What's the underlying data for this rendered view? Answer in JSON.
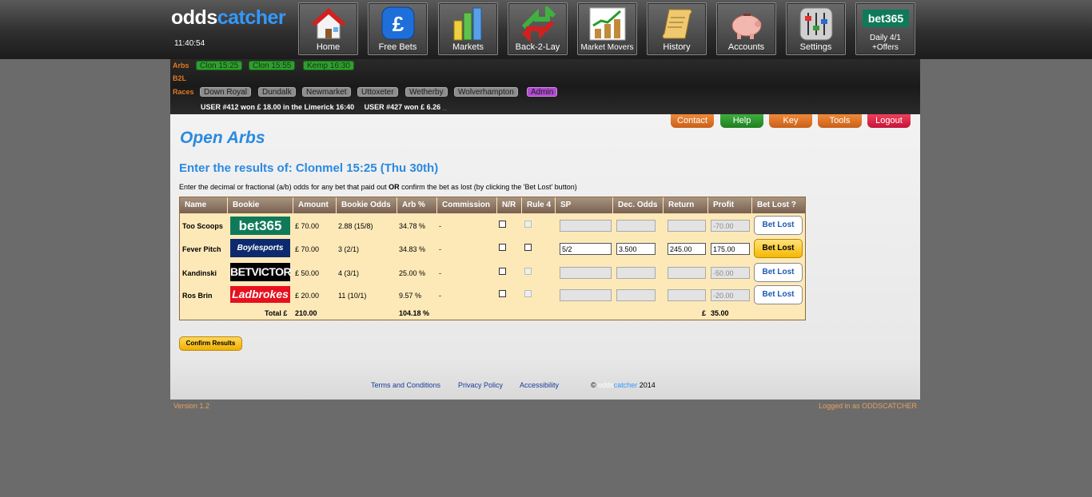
{
  "brand": {
    "part1": "odds",
    "part2": "catcher"
  },
  "clock": "11:40:54",
  "nav": [
    {
      "label": "Home",
      "icon": "home-icon"
    },
    {
      "label": "Free Bets",
      "icon": "pound-icon"
    },
    {
      "label": "Markets",
      "icon": "bar-chart-icon"
    },
    {
      "label": "Back-2-Lay",
      "icon": "arrows-icon"
    },
    {
      "label": "Market Movers",
      "icon": "trend-chart-icon"
    },
    {
      "label": "History",
      "icon": "scroll-icon"
    },
    {
      "label": "Accounts",
      "icon": "piggy-bank-icon"
    },
    {
      "label": "Settings",
      "icon": "sliders-icon"
    },
    {
      "label_line1": "Daily 4/1",
      "label_line2": "+Offers",
      "logo_text": "bet365",
      "icon": "bet365-logo"
    }
  ],
  "subnav": {
    "arbs_label": "Arbs",
    "arbs": [
      "Clon 15:25",
      "Clon 15:55",
      "Kemp 16:30"
    ],
    "b2l_label": "B2L",
    "races_label": "Races",
    "races": [
      "Down Royal",
      "Dundalk",
      "Newmarket",
      "Uttoxeter",
      "Wetherby",
      "Wolverhampton"
    ],
    "admin": "Admin",
    "ticker": "USER #412 won £ 18.00 in the Limerick 16:40     USER #427 won £ 6.26",
    "ticker_cursor": "_"
  },
  "top_buttons": {
    "contact": "Contact",
    "help": "Help",
    "key": "Key",
    "tools": "Tools",
    "logout": "Logout"
  },
  "page": {
    "title": "Open Arbs",
    "subtitle": "Enter the results of: Clonmel 15:25 (Thu 30th)",
    "instruction_pre": "Enter the decimal or fractional (a/b) odds for any bet that paid out ",
    "instruction_or": "OR",
    "instruction_post": " confirm the bet as lost (by clicking the 'Bet Lost' button)"
  },
  "table": {
    "headers": [
      "Name",
      "Bookie",
      "Amount",
      "Bookie Odds",
      "Arb %",
      "Commission",
      "N/R",
      "Rule 4",
      "SP",
      "Dec. Odds",
      "Return",
      "Profit",
      "Bet Lost ?"
    ],
    "rows": [
      {
        "name": "Too Scoops",
        "bookie": "bet365",
        "amount": "£ 70.00",
        "odds": "2.88 (15/8)",
        "arb": "34.78 %",
        "commission": "-",
        "sp": "",
        "dec": "",
        "return": "",
        "profit": "-70.00",
        "btn": "Bet Lost",
        "active": false
      },
      {
        "name": "Fever Pitch",
        "bookie": "Boylesports",
        "amount": "£ 70.00",
        "odds": "3 (2/1)",
        "arb": "34.83 %",
        "commission": "-",
        "sp": "5/2",
        "dec": "3.500",
        "return": "245.00",
        "profit": "175.00",
        "btn": "Bet Lost",
        "active": true
      },
      {
        "name": "Kandinski",
        "bookie": "BETVICTOR",
        "amount": "£ 50.00",
        "odds": "4 (3/1)",
        "arb": "25.00 %",
        "commission": "-",
        "sp": "",
        "dec": "",
        "return": "",
        "profit": "-50.00",
        "btn": "Bet Lost",
        "active": false
      },
      {
        "name": "Ros Brin",
        "bookie": "Ladbrokes",
        "amount": "£ 20.00",
        "odds": "11 (10/1)",
        "arb": "9.57 %",
        "commission": "-",
        "sp": "",
        "dec": "",
        "return": "",
        "profit": "-20.00",
        "btn": "Bet Lost",
        "active": false
      }
    ],
    "total_label": "Total £",
    "total_amount": "210.00",
    "total_arb": "104.18 %",
    "total_profit_currency": "£",
    "total_profit": "35.00"
  },
  "confirm_button": "Confirm Results",
  "footer": {
    "terms": "Terms and Conditions",
    "privacy": "Privacy Policy",
    "accessibility": "Accessibility",
    "copyright_symbol": "©",
    "copyright_year": "2014",
    "version": "Version 1.2",
    "logged_in": "Logged in as ODDSCATCHER"
  }
}
